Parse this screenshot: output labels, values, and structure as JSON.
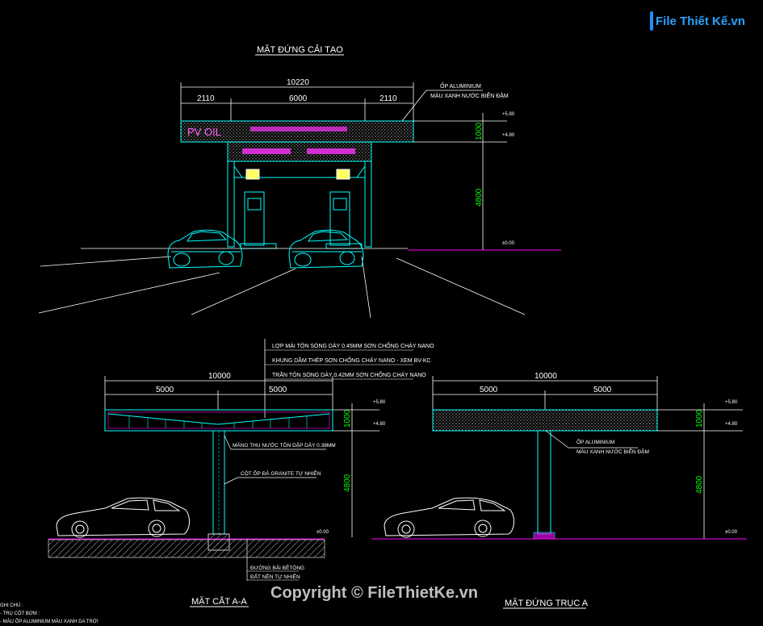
{
  "watermark": {
    "logo_text": "File Thiết Kế.vn",
    "copyright": "Copyright © FileThietKe.vn"
  },
  "front": {
    "title": "MẶT ĐỨNG CẢI TẠO",
    "dim_total": "10220",
    "dim_left": "2110",
    "dim_mid": "6000",
    "dim_right": "2110",
    "dim_canopy_h": "1000",
    "dim_column_h": "4800",
    "lvl_top": "+5.80",
    "lvl_mid": "+4.80",
    "lvl_ground": "±0.00",
    "note_cladding": "ỐP ALUMINIUM",
    "note_color": "MÀU XANH NƯỚC BIỂN ĐẬM",
    "sign_brand": "PV OIL"
  },
  "section": {
    "title": "MẶT CẮT A-A",
    "note_roof": "LỢP MÁI TÔN SÓNG DÀY 0.45MM SƠN CHỐNG CHÁY NANO",
    "note_frame": "KHUNG DẦM THÉP SƠN CHỐNG CHÁY NANO - XEM BV-KC",
    "note_ceiling": "TRẦN TÔN SÓNG DÀY 0.42MM SƠN CHỐNG CHÁY NANO",
    "dim_total": "10000",
    "dim_left": "5000",
    "dim_right": "5000",
    "dim_canopy_h": "1000",
    "dim_column_h": "4800",
    "lvl_top": "+5.80",
    "lvl_mid": "+4.80",
    "lvl_ground": "±0.00",
    "note_gutter": "MÁNG THU NƯỚC TÔN DẬP DÀY 0.38MM",
    "note_column": "CỘT ỐP ĐÁ GRANITE TỰ NHIÊN",
    "note_concrete": "ĐƯỜNG BÃI BÊTÔNG",
    "note_soil": "ĐẤT NỀN TỰ NHIÊN"
  },
  "side": {
    "title": "MẶT ĐỨNG TRỤC A",
    "dim_total": "10000",
    "dim_left": "5000",
    "dim_right": "5000",
    "dim_canopy_h": "1000",
    "dim_column_h": "4800",
    "lvl_top": "+5.80",
    "lvl_mid": "+4.80",
    "lvl_ground": "±0.00",
    "note_cladding": "ỐP ALUMINIUM",
    "note_color": "MÀU XANH NƯỚC BIỂN ĐẬM"
  },
  "legend": {
    "line1": "GHI CHÚ :",
    "line2": "- TRỤ CỘT BƠM :",
    "line3": "- MÀU ỐP ALUMINIUM MÀU XANH DA TRỜI"
  },
  "colors": {
    "background": "#000000",
    "dimension": "#00ff00",
    "outline": "#00ffff",
    "ground": "#ff00ff",
    "annotation": "#ffffff"
  }
}
